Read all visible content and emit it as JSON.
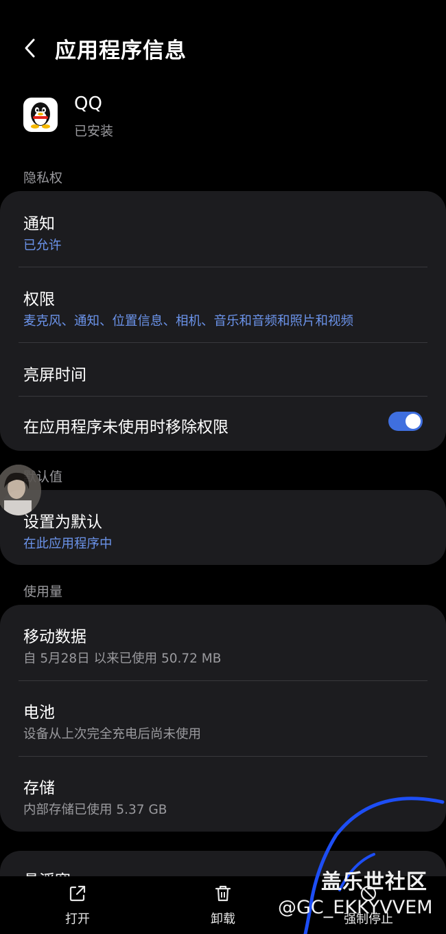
{
  "header": {
    "title": "应用程序信息"
  },
  "app": {
    "name": "QQ",
    "status": "已安装"
  },
  "sections": {
    "privacy": "隐私权",
    "defaults": "默认值",
    "usage": "使用量"
  },
  "privacy": {
    "notifications": {
      "title": "通知",
      "value": "已允许"
    },
    "permissions": {
      "title": "权限",
      "value": "麦克风、通知、位置信息、相机、音乐和音频和照片和视频"
    },
    "screen_time": {
      "title": "亮屏时间"
    },
    "remove_permissions": {
      "title": "在应用程序未使用时移除权限",
      "enabled": true
    }
  },
  "defaults": {
    "set_default": {
      "title": "设置为默认",
      "value": "在此应用程序中"
    }
  },
  "usage": {
    "mobile_data": {
      "title": "移动数据",
      "value": "自 5月28日 以来已使用 50.72 MB"
    },
    "battery": {
      "title": "电池",
      "value": "设备从上次完全充电后尚未使用"
    },
    "storage": {
      "title": "存储",
      "value": "内部存储已使用 5.37 GB"
    }
  },
  "partial_row": {
    "title": "悬浮窗"
  },
  "bottom_bar": {
    "open": "打开",
    "uninstall": "卸载",
    "force_stop": "强制停止"
  },
  "watermark": {
    "title": "盖乐世社区",
    "id": "@GC_EKKYVVEM"
  },
  "colors": {
    "background": "#000000",
    "card": "#1c1c1f",
    "accent": "#6b93ea",
    "toggle_on": "#3f6fdf"
  }
}
